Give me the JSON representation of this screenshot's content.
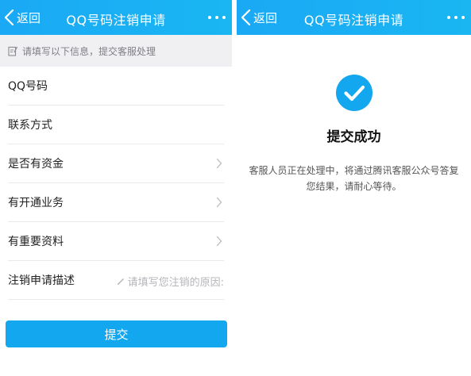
{
  "left_screen": {
    "nav": {
      "back_label": "返回",
      "title": "QQ号码注销申请"
    },
    "notice": "请填写以下信息，提交客服处理",
    "form_rows": [
      {
        "label": "QQ号码"
      },
      {
        "label": "联系方式"
      },
      {
        "label": "是否有资金"
      },
      {
        "label": "有开通业务"
      },
      {
        "label": "有重要资料"
      },
      {
        "label": "注销申请描述",
        "placeholder": "请填写您注销的原因:"
      }
    ],
    "submit_label": "提交"
  },
  "right_screen": {
    "nav": {
      "back_label": "返回",
      "title": "QQ号码注销申请"
    },
    "success_title": "提交成功",
    "success_desc": "客服人员正在处理中，将通过腾讯客服公众号答复您结果，请耐心等待。"
  },
  "colors": {
    "nav_bar": "#1aa9f5",
    "submit_button": "#12a7ef",
    "notice_bg": "#f0f0f3",
    "success_icon": "#12a7ef"
  },
  "icons": {
    "back": "chevron-left-icon",
    "more": "more-dots-icon",
    "notice": "edit-note-icon",
    "row_arrow": "chevron-right-icon",
    "pencil": "pencil-icon",
    "success": "check-circle-icon"
  }
}
